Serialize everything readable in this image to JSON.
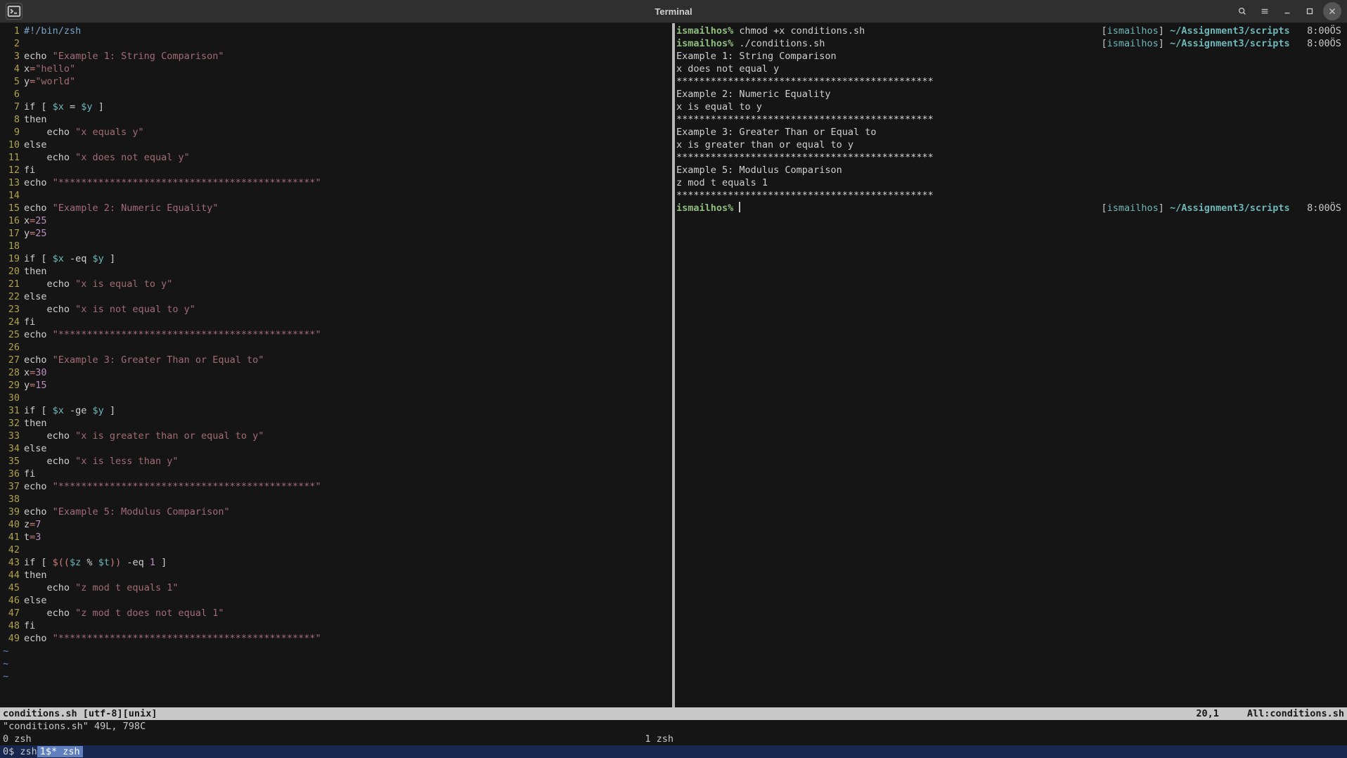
{
  "window": {
    "title": "Terminal"
  },
  "editor": {
    "lines": [
      {
        "n": 1,
        "segs": [
          {
            "c": "blueish",
            "t": "#!/bin/zsh"
          }
        ]
      },
      {
        "n": 2,
        "segs": []
      },
      {
        "n": 3,
        "segs": [
          {
            "c": "cmd",
            "t": "echo "
          },
          {
            "c": "str",
            "t": "\"Example 1: String Comparison\""
          }
        ]
      },
      {
        "n": 4,
        "segs": [
          {
            "c": "cmd",
            "t": "x"
          },
          {
            "c": "red",
            "t": "="
          },
          {
            "c": "str",
            "t": "\"hello\""
          }
        ]
      },
      {
        "n": 5,
        "segs": [
          {
            "c": "cmd",
            "t": "y"
          },
          {
            "c": "red",
            "t": "="
          },
          {
            "c": "str",
            "t": "\"world\""
          }
        ]
      },
      {
        "n": 6,
        "segs": []
      },
      {
        "n": 7,
        "segs": [
          {
            "c": "cmd",
            "t": "if [ "
          },
          {
            "c": "var",
            "t": "$x"
          },
          {
            "c": "cmd",
            "t": " = "
          },
          {
            "c": "var",
            "t": "$y"
          },
          {
            "c": "cmd",
            "t": " ]"
          }
        ]
      },
      {
        "n": 8,
        "segs": [
          {
            "c": "cmd",
            "t": "then"
          }
        ]
      },
      {
        "n": 9,
        "segs": [
          {
            "c": "cmd",
            "t": "    echo "
          },
          {
            "c": "str",
            "t": "\"x equals y\""
          }
        ]
      },
      {
        "n": 10,
        "segs": [
          {
            "c": "cmd",
            "t": "else"
          }
        ]
      },
      {
        "n": 11,
        "segs": [
          {
            "c": "cmd",
            "t": "    echo "
          },
          {
            "c": "str",
            "t": "\"x does not equal y\""
          }
        ]
      },
      {
        "n": 12,
        "segs": [
          {
            "c": "cmd",
            "t": "fi"
          }
        ]
      },
      {
        "n": 13,
        "segs": [
          {
            "c": "cmd",
            "t": "echo "
          },
          {
            "c": "str",
            "t": "\"*********************************************\""
          }
        ]
      },
      {
        "n": 14,
        "segs": []
      },
      {
        "n": 15,
        "segs": [
          {
            "c": "cmd",
            "t": "echo "
          },
          {
            "c": "str",
            "t": "\"Example 2: Numeric Equality\""
          }
        ]
      },
      {
        "n": 16,
        "segs": [
          {
            "c": "cmd",
            "t": "x"
          },
          {
            "c": "red",
            "t": "="
          },
          {
            "c": "num",
            "t": "25"
          }
        ]
      },
      {
        "n": 17,
        "segs": [
          {
            "c": "cmd",
            "t": "y"
          },
          {
            "c": "red",
            "t": "="
          },
          {
            "c": "num",
            "t": "25"
          }
        ]
      },
      {
        "n": 18,
        "segs": []
      },
      {
        "n": 19,
        "segs": [
          {
            "c": "cmd",
            "t": "if [ "
          },
          {
            "c": "var",
            "t": "$x"
          },
          {
            "c": "cmd",
            "t": " -eq "
          },
          {
            "c": "var",
            "t": "$y"
          },
          {
            "c": "cmd",
            "t": " ]"
          }
        ]
      },
      {
        "n": 20,
        "segs": [
          {
            "c": "cmd",
            "t": "then"
          }
        ]
      },
      {
        "n": 21,
        "segs": [
          {
            "c": "cmd",
            "t": "    echo "
          },
          {
            "c": "str",
            "t": "\"x is equal to y\""
          }
        ]
      },
      {
        "n": 22,
        "segs": [
          {
            "c": "cmd",
            "t": "else"
          }
        ]
      },
      {
        "n": 23,
        "segs": [
          {
            "c": "cmd",
            "t": "    echo "
          },
          {
            "c": "str",
            "t": "\"x is not equal to y\""
          }
        ]
      },
      {
        "n": 24,
        "segs": [
          {
            "c": "cmd",
            "t": "fi"
          }
        ]
      },
      {
        "n": 25,
        "segs": [
          {
            "c": "cmd",
            "t": "echo "
          },
          {
            "c": "str",
            "t": "\"*********************************************\""
          }
        ]
      },
      {
        "n": 26,
        "segs": []
      },
      {
        "n": 27,
        "segs": [
          {
            "c": "cmd",
            "t": "echo "
          },
          {
            "c": "str",
            "t": "\"Example 3: Greater Than or Equal to\""
          }
        ]
      },
      {
        "n": 28,
        "segs": [
          {
            "c": "cmd",
            "t": "x"
          },
          {
            "c": "red",
            "t": "="
          },
          {
            "c": "num",
            "t": "30"
          }
        ]
      },
      {
        "n": 29,
        "segs": [
          {
            "c": "cmd",
            "t": "y"
          },
          {
            "c": "red",
            "t": "="
          },
          {
            "c": "num",
            "t": "15"
          }
        ]
      },
      {
        "n": 30,
        "segs": []
      },
      {
        "n": 31,
        "segs": [
          {
            "c": "cmd",
            "t": "if [ "
          },
          {
            "c": "var",
            "t": "$x"
          },
          {
            "c": "cmd",
            "t": " -ge "
          },
          {
            "c": "var",
            "t": "$y"
          },
          {
            "c": "cmd",
            "t": " ]"
          }
        ]
      },
      {
        "n": 32,
        "segs": [
          {
            "c": "cmd",
            "t": "then"
          }
        ]
      },
      {
        "n": 33,
        "segs": [
          {
            "c": "cmd",
            "t": "    echo "
          },
          {
            "c": "str",
            "t": "\"x is greater than or equal to y\""
          }
        ]
      },
      {
        "n": 34,
        "segs": [
          {
            "c": "cmd",
            "t": "else"
          }
        ]
      },
      {
        "n": 35,
        "segs": [
          {
            "c": "cmd",
            "t": "    echo "
          },
          {
            "c": "str",
            "t": "\"x is less than y\""
          }
        ]
      },
      {
        "n": 36,
        "segs": [
          {
            "c": "cmd",
            "t": "fi"
          }
        ]
      },
      {
        "n": 37,
        "segs": [
          {
            "c": "cmd",
            "t": "echo "
          },
          {
            "c": "str",
            "t": "\"*********************************************\""
          }
        ]
      },
      {
        "n": 38,
        "segs": []
      },
      {
        "n": 39,
        "segs": [
          {
            "c": "cmd",
            "t": "echo "
          },
          {
            "c": "str",
            "t": "\"Example 5: Modulus Comparison\""
          }
        ]
      },
      {
        "n": 40,
        "segs": [
          {
            "c": "cmd",
            "t": "z"
          },
          {
            "c": "red",
            "t": "="
          },
          {
            "c": "num",
            "t": "7"
          }
        ]
      },
      {
        "n": 41,
        "segs": [
          {
            "c": "cmd",
            "t": "t"
          },
          {
            "c": "red",
            "t": "="
          },
          {
            "c": "num",
            "t": "3"
          }
        ]
      },
      {
        "n": 42,
        "segs": []
      },
      {
        "n": 43,
        "segs": [
          {
            "c": "cmd",
            "t": "if [ "
          },
          {
            "c": "red",
            "t": "$(("
          },
          {
            "c": "var",
            "t": "$z"
          },
          {
            "c": "cmd",
            "t": " % "
          },
          {
            "c": "var",
            "t": "$t"
          },
          {
            "c": "red",
            "t": "))"
          },
          {
            "c": "cmd",
            "t": " -eq "
          },
          {
            "c": "num",
            "t": "1"
          },
          {
            "c": "cmd",
            "t": " ]"
          }
        ]
      },
      {
        "n": 44,
        "segs": [
          {
            "c": "cmd",
            "t": "then"
          }
        ]
      },
      {
        "n": 45,
        "segs": [
          {
            "c": "cmd",
            "t": "    echo "
          },
          {
            "c": "str",
            "t": "\"z mod t equals 1\""
          }
        ]
      },
      {
        "n": 46,
        "segs": [
          {
            "c": "cmd",
            "t": "else"
          }
        ]
      },
      {
        "n": 47,
        "segs": [
          {
            "c": "cmd",
            "t": "    echo "
          },
          {
            "c": "str",
            "t": "\"z mod t does not equal 1\""
          }
        ]
      },
      {
        "n": 48,
        "segs": [
          {
            "c": "cmd",
            "t": "fi"
          }
        ]
      },
      {
        "n": 49,
        "segs": [
          {
            "c": "cmd",
            "t": "echo "
          },
          {
            "c": "str",
            "t": "\"*********************************************\""
          }
        ]
      }
    ],
    "tildes": 3
  },
  "right_pane": {
    "prompts": [
      {
        "host": "ismailhos%",
        "cmd": " chmod +x conditions.sh",
        "user": "ismailhos",
        "path": "~/Assignment3/scripts",
        "time": "8:00ÖS"
      },
      {
        "host": "ismailhos%",
        "cmd": " ./conditions.sh",
        "user": "ismailhos",
        "path": "~/Assignment3/scripts",
        "time": "8:00ÖS"
      }
    ],
    "output": [
      "Example 1: String Comparison",
      "x does not equal y",
      "*********************************************",
      "Example 2: Numeric Equality",
      "x is equal to y",
      "*********************************************",
      "Example 3: Greater Than or Equal to",
      "x is greater than or equal to y",
      "*********************************************",
      "Example 5: Modulus Comparison",
      "z mod t equals 1",
      "*********************************************"
    ],
    "final_prompt": {
      "host": "ismailhos%",
      "user": "ismailhos",
      "path": "~/Assignment3/scripts",
      "time": "8:00ÖS"
    }
  },
  "status": {
    "line1_left": "conditions.sh [utf-8][unix]",
    "line1_mid": "20,1",
    "line1_right": "All:conditions.sh",
    "line2": "\"conditions.sh\" 49L, 798C"
  },
  "tmux": {
    "left": "  0 zsh",
    "right": "1 zsh"
  },
  "bottom": {
    "seg1": "0$ zsh ",
    "seg2": " 1$* zsh "
  }
}
